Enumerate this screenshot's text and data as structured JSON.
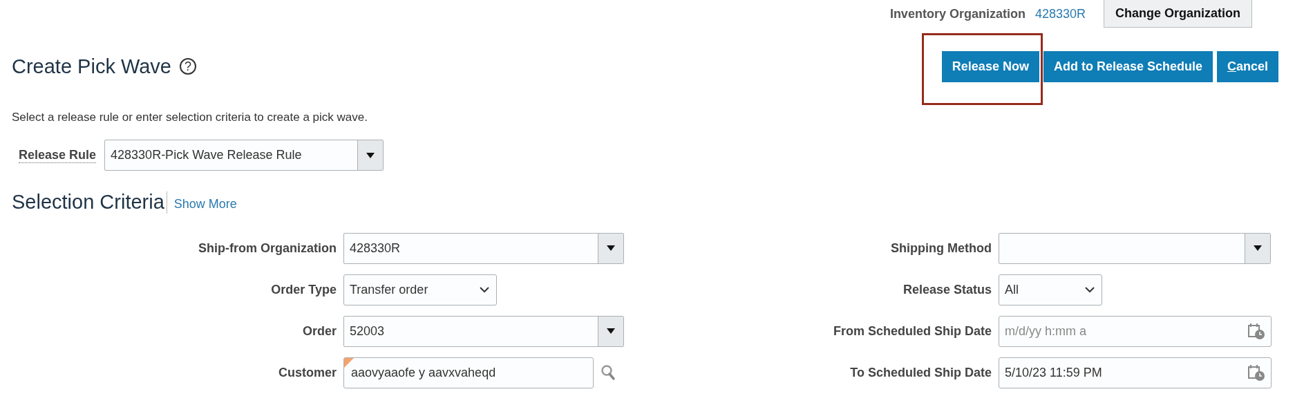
{
  "org_bar": {
    "label": "Inventory Organization",
    "value": "428330R",
    "button": "Change Organization"
  },
  "header": {
    "title": "Create Pick Wave",
    "help": "?",
    "buttons": [
      {
        "label": "Release Now",
        "kind": "primary",
        "highlighted": true
      },
      {
        "label": "Add to Release Schedule",
        "kind": "primary",
        "highlighted": false
      },
      {
        "label": "Cancel",
        "kind": "primary",
        "highlighted": false
      }
    ]
  },
  "instructions": "Select a release rule or enter selection criteria to create a pick wave.",
  "release_rule": {
    "label": "Release Rule",
    "value": "428330R-Pick Wave Release Rule"
  },
  "selection_criteria": {
    "title": "Selection Criteria",
    "link": "Show More",
    "left": [
      {
        "label": "Ship-from Organization",
        "kind": "combo",
        "value": "428330R"
      },
      {
        "label": "Order Type",
        "kind": "select",
        "value": "Transfer order"
      },
      {
        "label": "Order",
        "kind": "combo",
        "value": "52003"
      },
      {
        "label": "Customer",
        "kind": "lov",
        "value": "aaovyaaofe y aavxvaheqd",
        "changed": true
      }
    ],
    "right": [
      {
        "label": "Shipping Method",
        "kind": "combo"
      },
      {
        "label": "Release Status",
        "kind": "select",
        "value": "All"
      },
      {
        "label": "From Scheduled Ship Date",
        "kind": "date",
        "placeholder": "m/d/yy h:mm a"
      },
      {
        "label": "To Scheduled Ship Date",
        "kind": "date",
        "value": "5/10/23 11:59 PM"
      }
    ]
  }
}
